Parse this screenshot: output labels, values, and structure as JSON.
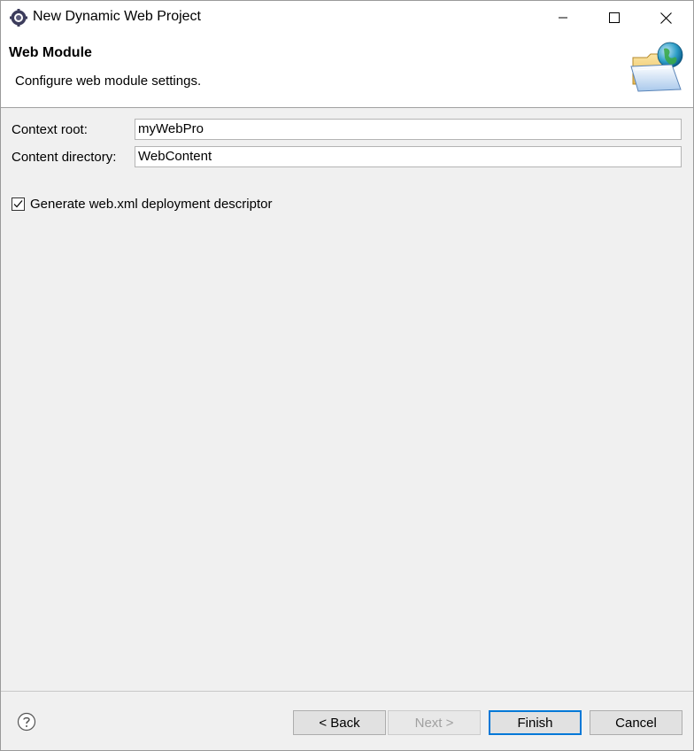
{
  "window": {
    "title": "New Dynamic Web Project",
    "icons": {
      "app": "eclipse-gear-icon",
      "minimize": "minimize-icon",
      "maximize": "maximize-icon",
      "close": "close-icon"
    }
  },
  "banner": {
    "title": "Web Module",
    "description": "Configure web module settings.",
    "icon": "folder-globe-icon"
  },
  "form": {
    "context_root": {
      "label": "Context root:",
      "value": "myWebPro"
    },
    "content_directory": {
      "label": "Content directory:",
      "value": "WebContent"
    },
    "generate_descriptor": {
      "label": "Generate web.xml deployment descriptor",
      "checked": true
    }
  },
  "footer": {
    "help_icon": "help-icon",
    "back_label": "< Back",
    "next_label": "Next >",
    "finish_label": "Finish",
    "cancel_label": "Cancel",
    "next_enabled": false
  },
  "colors": {
    "dialog_bg": "#f0f0f0",
    "banner_bg": "#ffffff",
    "default_button_border": "#0078d7",
    "disabled_text": "#a0a0a0"
  }
}
